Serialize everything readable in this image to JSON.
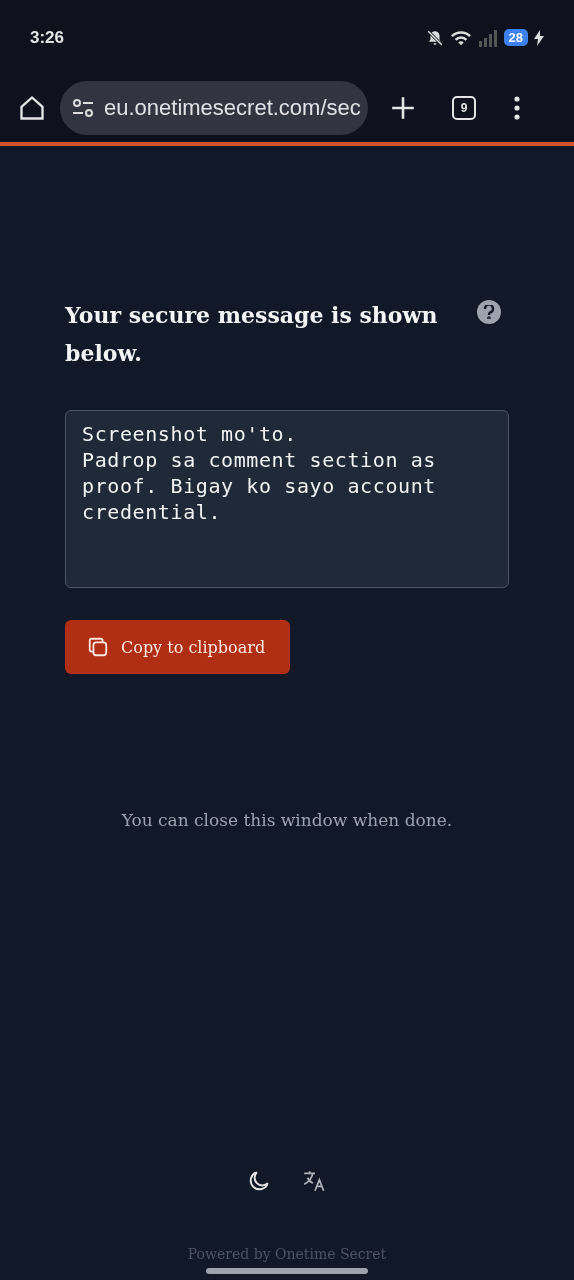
{
  "status_bar": {
    "time": "3:26",
    "battery": "28"
  },
  "browser": {
    "url": "eu.onetimesecret.com/sec",
    "tab_count": "9"
  },
  "page": {
    "heading": "Your secure message is shown below.",
    "message": "Screenshot mo'to.\nPadrop sa comment section as proof. Bigay ko sayo account credential.",
    "copy_button": "Copy to clipboard",
    "note": "You can close this window when done.",
    "footer": "Powered by Onetime Secret"
  }
}
